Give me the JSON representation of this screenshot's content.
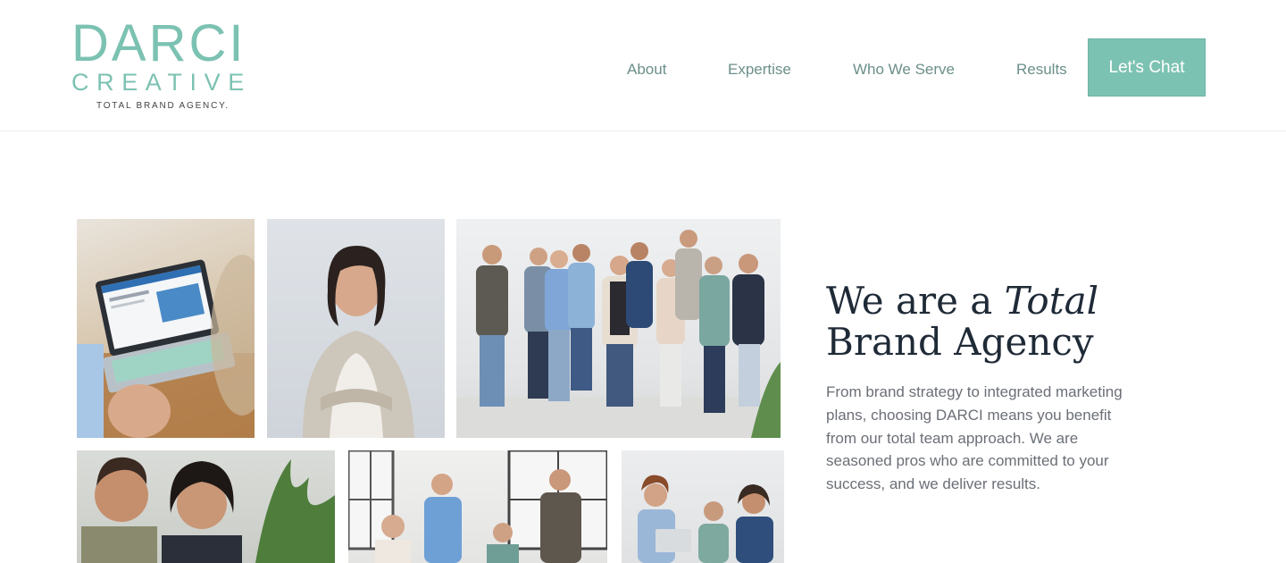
{
  "brand": {
    "line1": "DARCI",
    "line2": "CREATIVE",
    "tagline": "TOTAL BRAND AGENCY.",
    "accent_color": "#7cc2b2"
  },
  "nav": {
    "items": [
      {
        "label": "About"
      },
      {
        "label": "Expertise"
      },
      {
        "label": "Who We Serve"
      },
      {
        "label": "Results"
      }
    ],
    "cta_label": "Let's Chat"
  },
  "hero": {
    "headline_part1": "We are a ",
    "headline_italic": "Total",
    "headline_part2": "Brand Agency",
    "body": "From brand strategy to integrated marketing plans, choosing DARCI means you benefit from our total team approach.  We are seasoned pros who are committed to your success, and we deliver results."
  }
}
